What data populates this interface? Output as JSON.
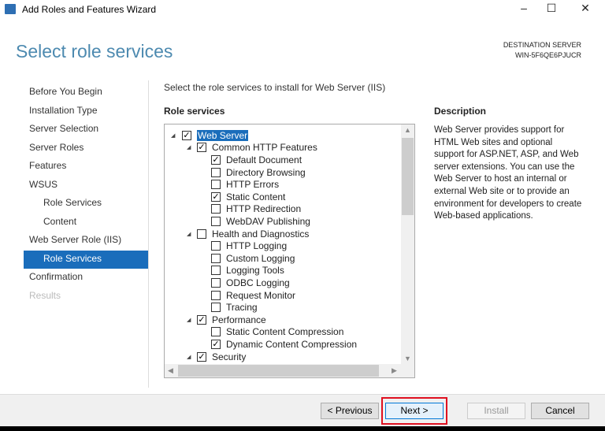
{
  "window": {
    "title": "Add Roles and Features Wizard",
    "controls": {
      "minimize": "–",
      "maximize": "☐",
      "close": "✕"
    }
  },
  "header": {
    "page_title": "Select role services",
    "dest_label": "DESTINATION SERVER",
    "dest_server": "WIN-5F6QE6PJUCR"
  },
  "nav": [
    {
      "label": "Before You Begin",
      "state": "normal",
      "sub": false
    },
    {
      "label": "Installation Type",
      "state": "normal",
      "sub": false
    },
    {
      "label": "Server Selection",
      "state": "normal",
      "sub": false
    },
    {
      "label": "Server Roles",
      "state": "normal",
      "sub": false
    },
    {
      "label": "Features",
      "state": "normal",
      "sub": false
    },
    {
      "label": "WSUS",
      "state": "normal",
      "sub": false
    },
    {
      "label": "Role Services",
      "state": "normal",
      "sub": true
    },
    {
      "label": "Content",
      "state": "normal",
      "sub": true
    },
    {
      "label": "Web Server Role (IIS)",
      "state": "normal",
      "sub": false
    },
    {
      "label": "Role Services",
      "state": "active",
      "sub": true
    },
    {
      "label": "Confirmation",
      "state": "normal",
      "sub": false
    },
    {
      "label": "Results",
      "state": "disabled",
      "sub": false
    }
  ],
  "main": {
    "intro": "Select the role services to install for Web Server (IIS)",
    "role_services_label": "Role services",
    "tree": [
      {
        "label": "Web Server",
        "level": 0,
        "checked": true,
        "expandable": true,
        "selected": true
      },
      {
        "label": "Common HTTP Features",
        "level": 1,
        "checked": true,
        "expandable": true
      },
      {
        "label": "Default Document",
        "level": 2,
        "checked": true
      },
      {
        "label": "Directory Browsing",
        "level": 2,
        "checked": false
      },
      {
        "label": "HTTP Errors",
        "level": 2,
        "checked": false
      },
      {
        "label": "Static Content",
        "level": 2,
        "checked": true
      },
      {
        "label": "HTTP Redirection",
        "level": 2,
        "checked": false
      },
      {
        "label": "WebDAV Publishing",
        "level": 2,
        "checked": false
      },
      {
        "label": "Health and Diagnostics",
        "level": 1,
        "checked": false,
        "expandable": true
      },
      {
        "label": "HTTP Logging",
        "level": 2,
        "checked": false
      },
      {
        "label": "Custom Logging",
        "level": 2,
        "checked": false
      },
      {
        "label": "Logging Tools",
        "level": 2,
        "checked": false
      },
      {
        "label": "ODBC Logging",
        "level": 2,
        "checked": false
      },
      {
        "label": "Request Monitor",
        "level": 2,
        "checked": false
      },
      {
        "label": "Tracing",
        "level": 2,
        "checked": false
      },
      {
        "label": "Performance",
        "level": 1,
        "checked": true,
        "expandable": true
      },
      {
        "label": "Static Content Compression",
        "level": 2,
        "checked": false
      },
      {
        "label": "Dynamic Content Compression",
        "level": 2,
        "checked": true
      },
      {
        "label": "Security",
        "level": 1,
        "checked": true,
        "expandable": true
      }
    ],
    "description_label": "Description",
    "description": "Web Server provides support for HTML Web sites and optional support for ASP.NET, ASP, and Web server extensions. You can use the Web Server to host an internal or external Web site or to provide an environment for developers to create Web-based applications."
  },
  "footer": {
    "previous": "< Previous",
    "next": "Next >",
    "install": "Install",
    "cancel": "Cancel"
  }
}
